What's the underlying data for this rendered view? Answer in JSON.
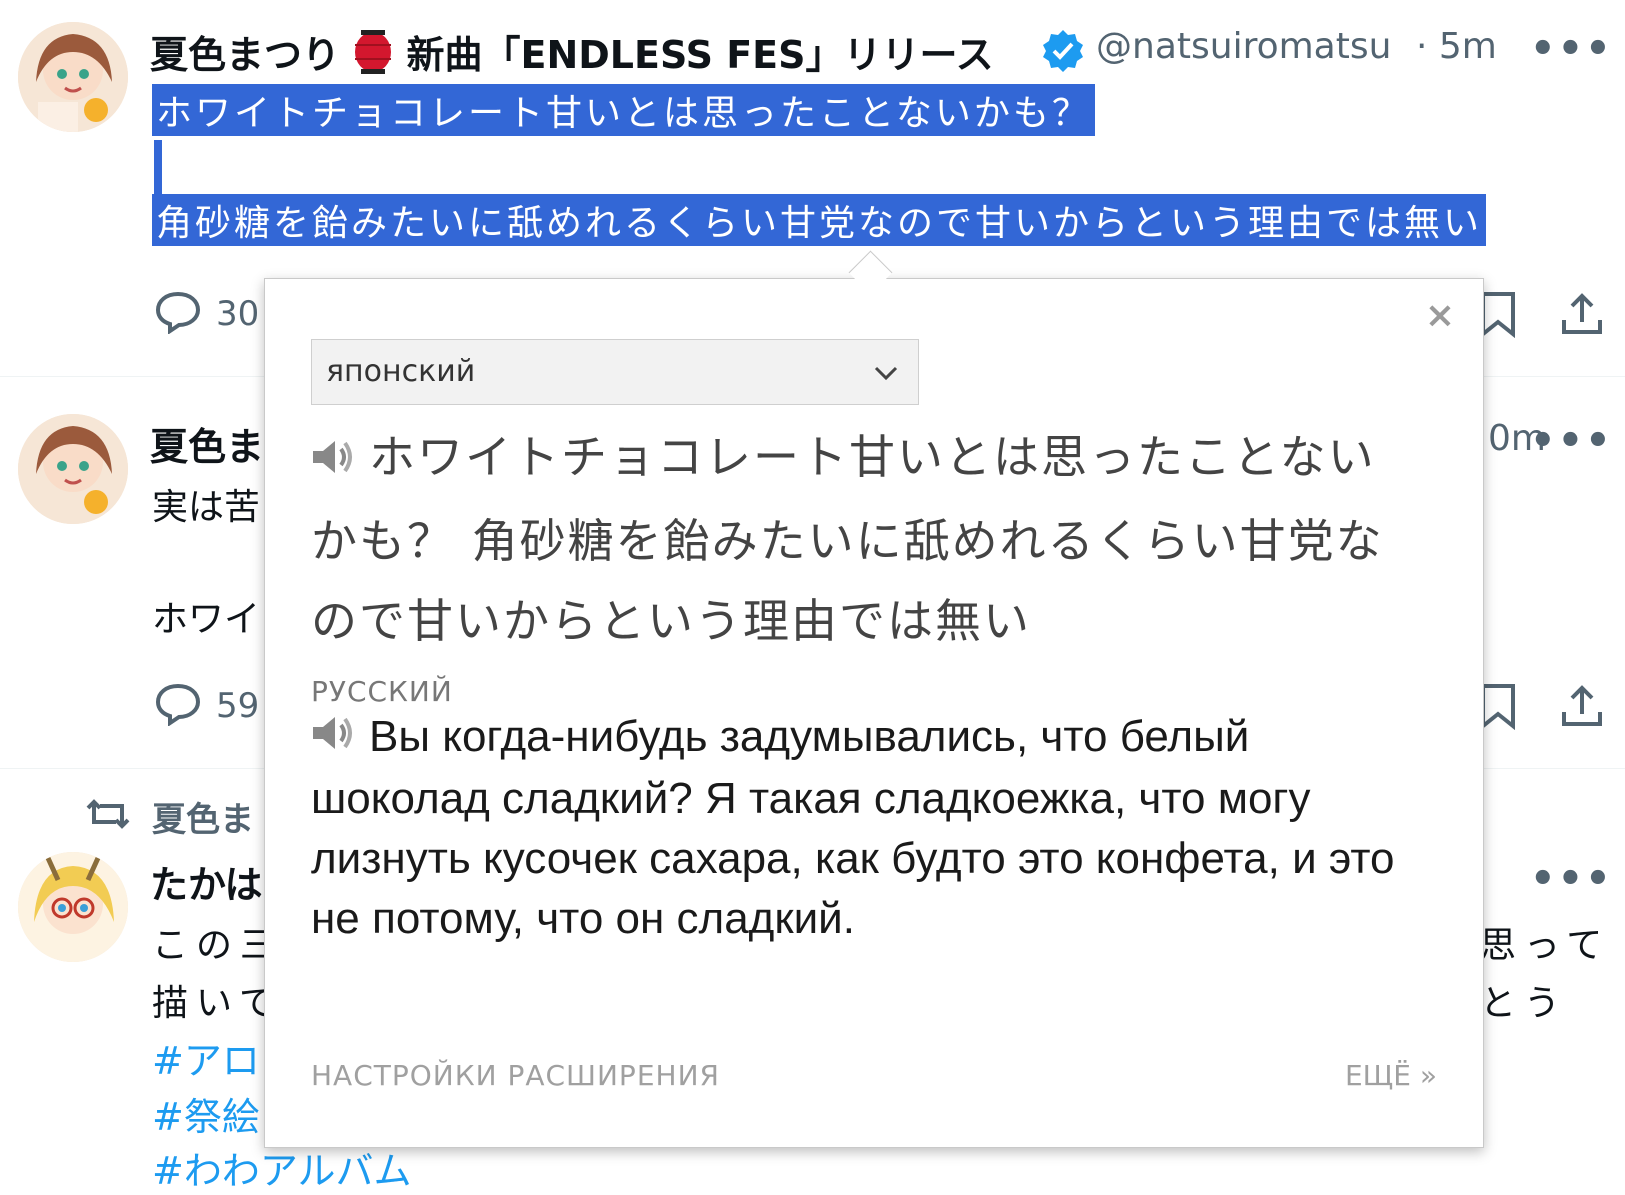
{
  "tweet1": {
    "author_name": "夏色まつり",
    "author_suffix": "新曲「ENDLESS FES」リリース",
    "handle": "@natsuiromatsu",
    "time_sep": "·",
    "time": "5m",
    "more": "•••",
    "line1": "ホワイトチョコレート甘いとは思ったことないかも？",
    "line2": "角砂糖を飴みたいに舐めれるくらい甘党なので甘いからという理由では無い",
    "reply_count": "30"
  },
  "tweet2": {
    "author_name": "夏色ま",
    "time": "0m",
    "more": "•••",
    "line1": "実は苦",
    "line2": "ホワイ",
    "reply_count": "59"
  },
  "tweet3": {
    "retweeter": "夏色ま",
    "author_name": "たかは",
    "more": "•••",
    "line1_left": "この三",
    "line1_right": "思って",
    "line2_left": "描いて",
    "line2_right": "とう",
    "hashtag1": "#アロ",
    "hashtag2": "#祭絵",
    "hashtag3": "#わわアルバム"
  },
  "popup": {
    "close": "×",
    "source_language": "японский",
    "source_text": "ホワイトチョコレート甘いとは思ったことないかも？ 角砂糖を飴みたいに舐めれるくらい甘党なので甘いからという理由では無い",
    "target_label": "РУССКИЙ",
    "target_text": "Вы когда-нибудь задумывались, что белый шоколад сладкий? Я такая сладкоежка, что могу лизнуть кусочек сахара, как будто это конфета, и это не потому, что он сладкий.",
    "settings_link": "НАСТРОЙКИ РАСШИРЕНИЯ",
    "more_link": "ЕЩЁ »"
  },
  "colors": {
    "selection": "#3367d6",
    "verified": "#1d9bf0",
    "hashtag": "#1d9bf0",
    "muted": "#536471"
  }
}
